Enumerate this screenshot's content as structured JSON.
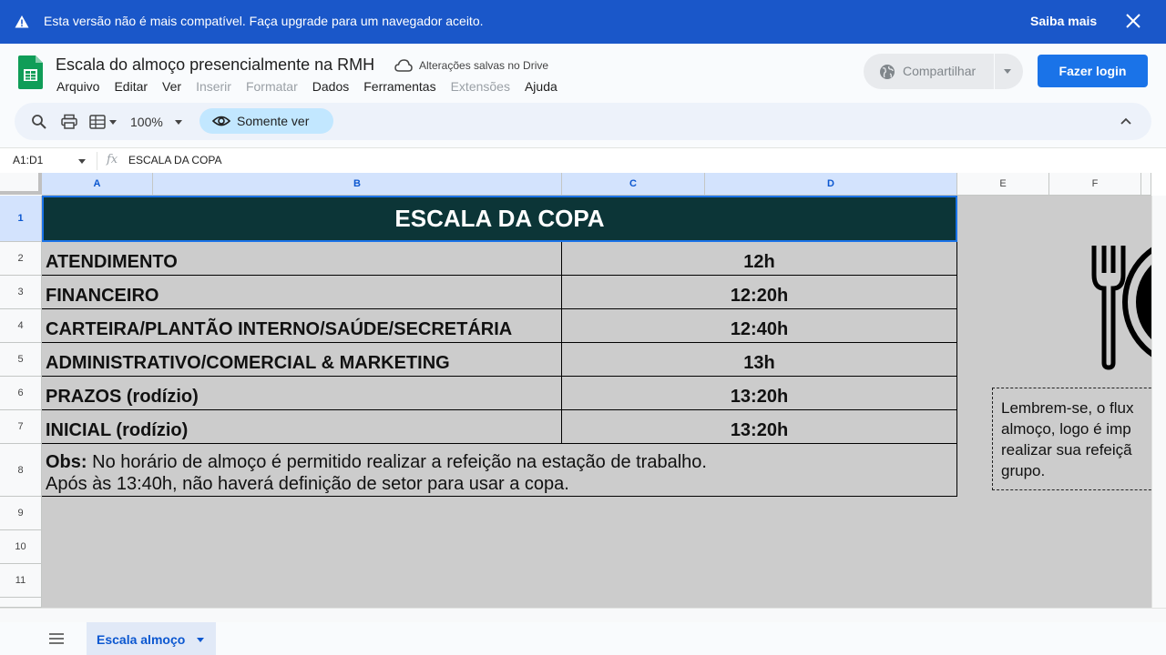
{
  "banner": {
    "message": "Esta versão não é mais compatível. Faça upgrade para um navegador aceito.",
    "learn_more": "Saiba mais",
    "icon": "warning-icon",
    "close_icon": "close-icon",
    "color": "#1a57c9"
  },
  "doc": {
    "title": "Escala do almoço presencialmente na RMH",
    "save_status": "Alterações salvas no Drive",
    "logo": "sheets-logo"
  },
  "menu": [
    {
      "label": "Arquivo",
      "enabled": true
    },
    {
      "label": "Editar",
      "enabled": true
    },
    {
      "label": "Ver",
      "enabled": true
    },
    {
      "label": "Inserir",
      "enabled": false
    },
    {
      "label": "Formatar",
      "enabled": false
    },
    {
      "label": "Dados",
      "enabled": true
    },
    {
      "label": "Ferramentas",
      "enabled": true
    },
    {
      "label": "Extensões",
      "enabled": false
    },
    {
      "label": "Ajuda",
      "enabled": true
    }
  ],
  "share": {
    "label": "Compartilhar"
  },
  "login": {
    "label": "Fazer login",
    "color": "#1a73e8"
  },
  "toolbar": {
    "zoom": "100%",
    "mode": "Somente ver"
  },
  "formula_bar": {
    "name_box": "A1:D1",
    "fx": "fx",
    "content": "ESCALA DA COPA"
  },
  "columns": [
    "A",
    "B",
    "C",
    "D",
    "E",
    "F"
  ],
  "rows": [
    "1",
    "2",
    "3",
    "4",
    "5",
    "6",
    "7",
    "8",
    "9",
    "10",
    "11"
  ],
  "sheet": {
    "title": "ESCALA DA COPA",
    "title_bg": "#0c3537",
    "schedule": [
      {
        "dept": "ATENDIMENTO",
        "time": "12h"
      },
      {
        "dept": "FINANCEIRO",
        "time": "12:20h"
      },
      {
        "dept": "CARTEIRA/PLANTÃO INTERNO/SAÚDE/SECRETÁRIA",
        "time": "12:40h"
      },
      {
        "dept": "ADMINISTRATIVO/COMERCIAL & MARKETING",
        "time": "13h"
      },
      {
        "dept": "PRAZOS (rodízio)",
        "time": "13:20h"
      },
      {
        "dept": "INICIAL (rodízio)",
        "time": "13:20h"
      }
    ],
    "obs_label": "Obs:",
    "obs_line1": "No horário de almoço é permitido realizar a refeição na estação de trabalho.",
    "obs_line2": "Após às 13:40h, não haverá definição de setor para usar a copa.",
    "note_lines": [
      "Lembrem-se, o flux",
      "almoço, logo é imp",
      "realizar sua refeiçã",
      "grupo."
    ]
  },
  "tabs": [
    {
      "label": "Escala almoço",
      "active": true
    }
  ]
}
